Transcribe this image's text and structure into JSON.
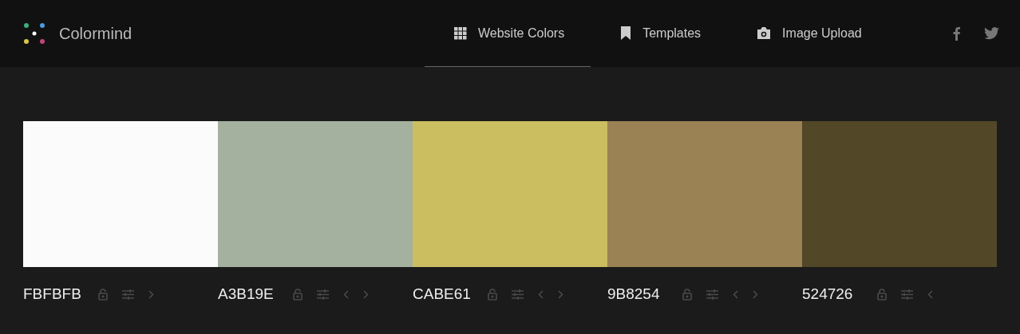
{
  "brand": {
    "name": "Colormind"
  },
  "nav": [
    {
      "label": "Website Colors",
      "selected": true
    },
    {
      "label": "Templates",
      "selected": false
    },
    {
      "label": "Image Upload",
      "selected": false
    }
  ],
  "palette": [
    {
      "hex": "FBFBFB",
      "color": "#fbfbfb"
    },
    {
      "hex": "A3B19E",
      "color": "#a3b19e"
    },
    {
      "hex": "CABE61",
      "color": "#cabe61"
    },
    {
      "hex": "9B8254",
      "color": "#9b8254"
    },
    {
      "hex": "524726",
      "color": "#524726"
    }
  ]
}
